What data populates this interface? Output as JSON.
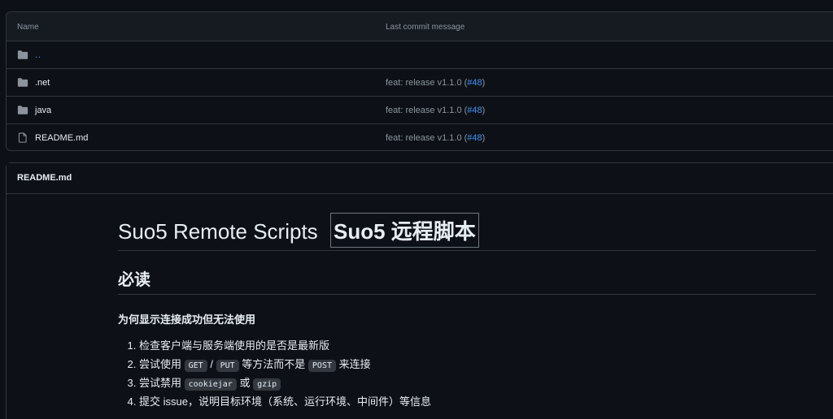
{
  "file_table": {
    "header": {
      "name_label": "Name",
      "commit_label": "Last commit message"
    },
    "rows": [
      {
        "name": "..",
        "type": "folder",
        "commit": "",
        "pr": ""
      },
      {
        "name": ".net",
        "type": "folder",
        "commit": "feat: release v1.1.0 (",
        "pr": "#48",
        "close": ")"
      },
      {
        "name": "java",
        "type": "folder",
        "commit": "feat: release v1.1.0 (",
        "pr": "#48",
        "close": ")"
      },
      {
        "name": "README.md",
        "type": "file",
        "commit": "feat: release v1.1.0 (",
        "pr": "#48",
        "close": ")"
      }
    ]
  },
  "readme": {
    "header_title": "README.md",
    "h1_plain": "Suo5 Remote Scripts",
    "h1_boxed": "Suo5 远程脚本",
    "h2": "必读",
    "h4": "为何显示连接成功但无法使用",
    "list": {
      "item1": "检查客户端与服务端使用的是否是最新版",
      "item2_prefix": "尝试使用",
      "item2_code1": "GET",
      "item2_slash": "/",
      "item2_code2": "PUT",
      "item2_mid": "等方法而不是",
      "item2_code3": "POST",
      "item2_suffix": "来连接",
      "item3_prefix": "尝试禁用",
      "item3_code1": "cookiejar",
      "item3_mid": "或",
      "item3_code2": "gzip",
      "item4": "提交 issue，说明目标环境（系统、运行环境、中间件）等信息"
    }
  },
  "colors": {
    "background": "#0d1117",
    "border": "#30363d",
    "link": "#4493f8",
    "muted": "#8b949e",
    "folder_icon": "#8b949e"
  }
}
